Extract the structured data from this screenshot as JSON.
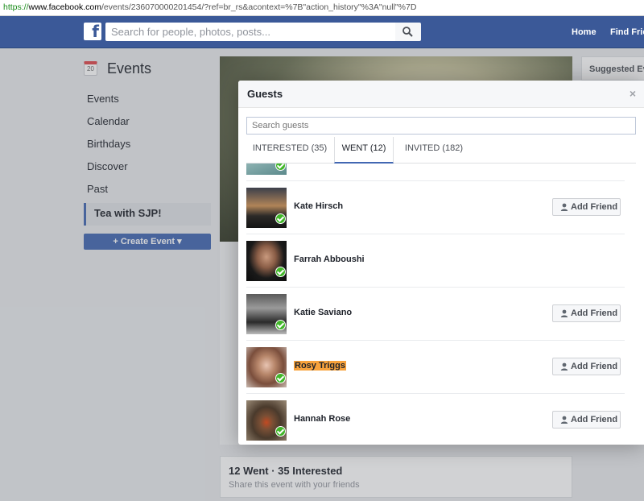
{
  "browser": {
    "url_scheme": "https://",
    "url_host": "www.facebook.com",
    "url_rest": "/events/236070000201454/?ref=br_rs&acontext=%7B\"action_history\"%3A\"null\"%7D"
  },
  "topnav": {
    "logo": "f",
    "search_placeholder": "Search for people, photos, posts...",
    "home": "Home",
    "find_friends": "Find Friends"
  },
  "sidebar": {
    "calendar_day": "20",
    "title": "Events",
    "items": [
      {
        "label": "Events"
      },
      {
        "label": "Calendar"
      },
      {
        "label": "Birthdays"
      },
      {
        "label": "Discover"
      },
      {
        "label": "Past"
      },
      {
        "label": "Tea with SJP!"
      }
    ],
    "create_button": "+ Create Event ▾"
  },
  "background": {
    "stats_title": "12 Went · 35 Interested",
    "stats_sub": "Share this event with your friends",
    "suggested": "Suggested Events"
  },
  "dialog": {
    "title": "Guests",
    "close": "×",
    "search_placeholder": "Search guests",
    "tabs": [
      {
        "label": "INTERESTED (35)"
      },
      {
        "label": "WENT (12)"
      },
      {
        "label": "INVITED (182)"
      }
    ],
    "add_friend_label": "Add Friend",
    "guests": [
      {
        "name": "Kate Hirsch"
      },
      {
        "name": "Farrah Abboushi"
      },
      {
        "name": "Katie Saviano"
      },
      {
        "name": "Rosy Triggs"
      },
      {
        "name": "Hannah Rose"
      }
    ]
  },
  "colors": {
    "fb_blue": "#3b5998",
    "button_blue": "#4267b2",
    "check_green": "#42b72a",
    "highlight": "#f7a23c"
  }
}
